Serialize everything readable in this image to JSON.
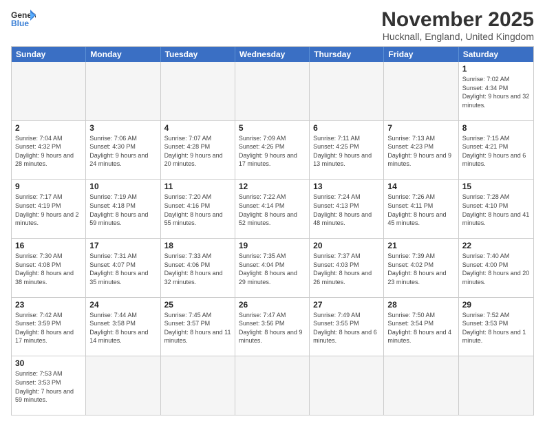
{
  "header": {
    "logo_general": "General",
    "logo_blue": "Blue",
    "month_title": "November 2025",
    "location": "Hucknall, England, United Kingdom"
  },
  "days_of_week": [
    "Sunday",
    "Monday",
    "Tuesday",
    "Wednesday",
    "Thursday",
    "Friday",
    "Saturday"
  ],
  "weeks": [
    [
      {
        "day": "",
        "info": ""
      },
      {
        "day": "",
        "info": ""
      },
      {
        "day": "",
        "info": ""
      },
      {
        "day": "",
        "info": ""
      },
      {
        "day": "",
        "info": ""
      },
      {
        "day": "",
        "info": ""
      },
      {
        "day": "1",
        "info": "Sunrise: 7:02 AM\nSunset: 4:34 PM\nDaylight: 9 hours\nand 32 minutes."
      }
    ],
    [
      {
        "day": "2",
        "info": "Sunrise: 7:04 AM\nSunset: 4:32 PM\nDaylight: 9 hours\nand 28 minutes."
      },
      {
        "day": "3",
        "info": "Sunrise: 7:06 AM\nSunset: 4:30 PM\nDaylight: 9 hours\nand 24 minutes."
      },
      {
        "day": "4",
        "info": "Sunrise: 7:07 AM\nSunset: 4:28 PM\nDaylight: 9 hours\nand 20 minutes."
      },
      {
        "day": "5",
        "info": "Sunrise: 7:09 AM\nSunset: 4:26 PM\nDaylight: 9 hours\nand 17 minutes."
      },
      {
        "day": "6",
        "info": "Sunrise: 7:11 AM\nSunset: 4:25 PM\nDaylight: 9 hours\nand 13 minutes."
      },
      {
        "day": "7",
        "info": "Sunrise: 7:13 AM\nSunset: 4:23 PM\nDaylight: 9 hours\nand 9 minutes."
      },
      {
        "day": "8",
        "info": "Sunrise: 7:15 AM\nSunset: 4:21 PM\nDaylight: 9 hours\nand 6 minutes."
      }
    ],
    [
      {
        "day": "9",
        "info": "Sunrise: 7:17 AM\nSunset: 4:19 PM\nDaylight: 9 hours\nand 2 minutes."
      },
      {
        "day": "10",
        "info": "Sunrise: 7:19 AM\nSunset: 4:18 PM\nDaylight: 8 hours\nand 59 minutes."
      },
      {
        "day": "11",
        "info": "Sunrise: 7:20 AM\nSunset: 4:16 PM\nDaylight: 8 hours\nand 55 minutes."
      },
      {
        "day": "12",
        "info": "Sunrise: 7:22 AM\nSunset: 4:14 PM\nDaylight: 8 hours\nand 52 minutes."
      },
      {
        "day": "13",
        "info": "Sunrise: 7:24 AM\nSunset: 4:13 PM\nDaylight: 8 hours\nand 48 minutes."
      },
      {
        "day": "14",
        "info": "Sunrise: 7:26 AM\nSunset: 4:11 PM\nDaylight: 8 hours\nand 45 minutes."
      },
      {
        "day": "15",
        "info": "Sunrise: 7:28 AM\nSunset: 4:10 PM\nDaylight: 8 hours\nand 41 minutes."
      }
    ],
    [
      {
        "day": "16",
        "info": "Sunrise: 7:30 AM\nSunset: 4:08 PM\nDaylight: 8 hours\nand 38 minutes."
      },
      {
        "day": "17",
        "info": "Sunrise: 7:31 AM\nSunset: 4:07 PM\nDaylight: 8 hours\nand 35 minutes."
      },
      {
        "day": "18",
        "info": "Sunrise: 7:33 AM\nSunset: 4:06 PM\nDaylight: 8 hours\nand 32 minutes."
      },
      {
        "day": "19",
        "info": "Sunrise: 7:35 AM\nSunset: 4:04 PM\nDaylight: 8 hours\nand 29 minutes."
      },
      {
        "day": "20",
        "info": "Sunrise: 7:37 AM\nSunset: 4:03 PM\nDaylight: 8 hours\nand 26 minutes."
      },
      {
        "day": "21",
        "info": "Sunrise: 7:39 AM\nSunset: 4:02 PM\nDaylight: 8 hours\nand 23 minutes."
      },
      {
        "day": "22",
        "info": "Sunrise: 7:40 AM\nSunset: 4:00 PM\nDaylight: 8 hours\nand 20 minutes."
      }
    ],
    [
      {
        "day": "23",
        "info": "Sunrise: 7:42 AM\nSunset: 3:59 PM\nDaylight: 8 hours\nand 17 minutes."
      },
      {
        "day": "24",
        "info": "Sunrise: 7:44 AM\nSunset: 3:58 PM\nDaylight: 8 hours\nand 14 minutes."
      },
      {
        "day": "25",
        "info": "Sunrise: 7:45 AM\nSunset: 3:57 PM\nDaylight: 8 hours\nand 11 minutes."
      },
      {
        "day": "26",
        "info": "Sunrise: 7:47 AM\nSunset: 3:56 PM\nDaylight: 8 hours\nand 9 minutes."
      },
      {
        "day": "27",
        "info": "Sunrise: 7:49 AM\nSunset: 3:55 PM\nDaylight: 8 hours\nand 6 minutes."
      },
      {
        "day": "28",
        "info": "Sunrise: 7:50 AM\nSunset: 3:54 PM\nDaylight: 8 hours\nand 4 minutes."
      },
      {
        "day": "29",
        "info": "Sunrise: 7:52 AM\nSunset: 3:53 PM\nDaylight: 8 hours\nand 1 minute."
      }
    ],
    [
      {
        "day": "30",
        "info": "Sunrise: 7:53 AM\nSunset: 3:53 PM\nDaylight: 7 hours\nand 59 minutes."
      },
      {
        "day": "",
        "info": ""
      },
      {
        "day": "",
        "info": ""
      },
      {
        "day": "",
        "info": ""
      },
      {
        "day": "",
        "info": ""
      },
      {
        "day": "",
        "info": ""
      },
      {
        "day": "",
        "info": ""
      }
    ]
  ]
}
